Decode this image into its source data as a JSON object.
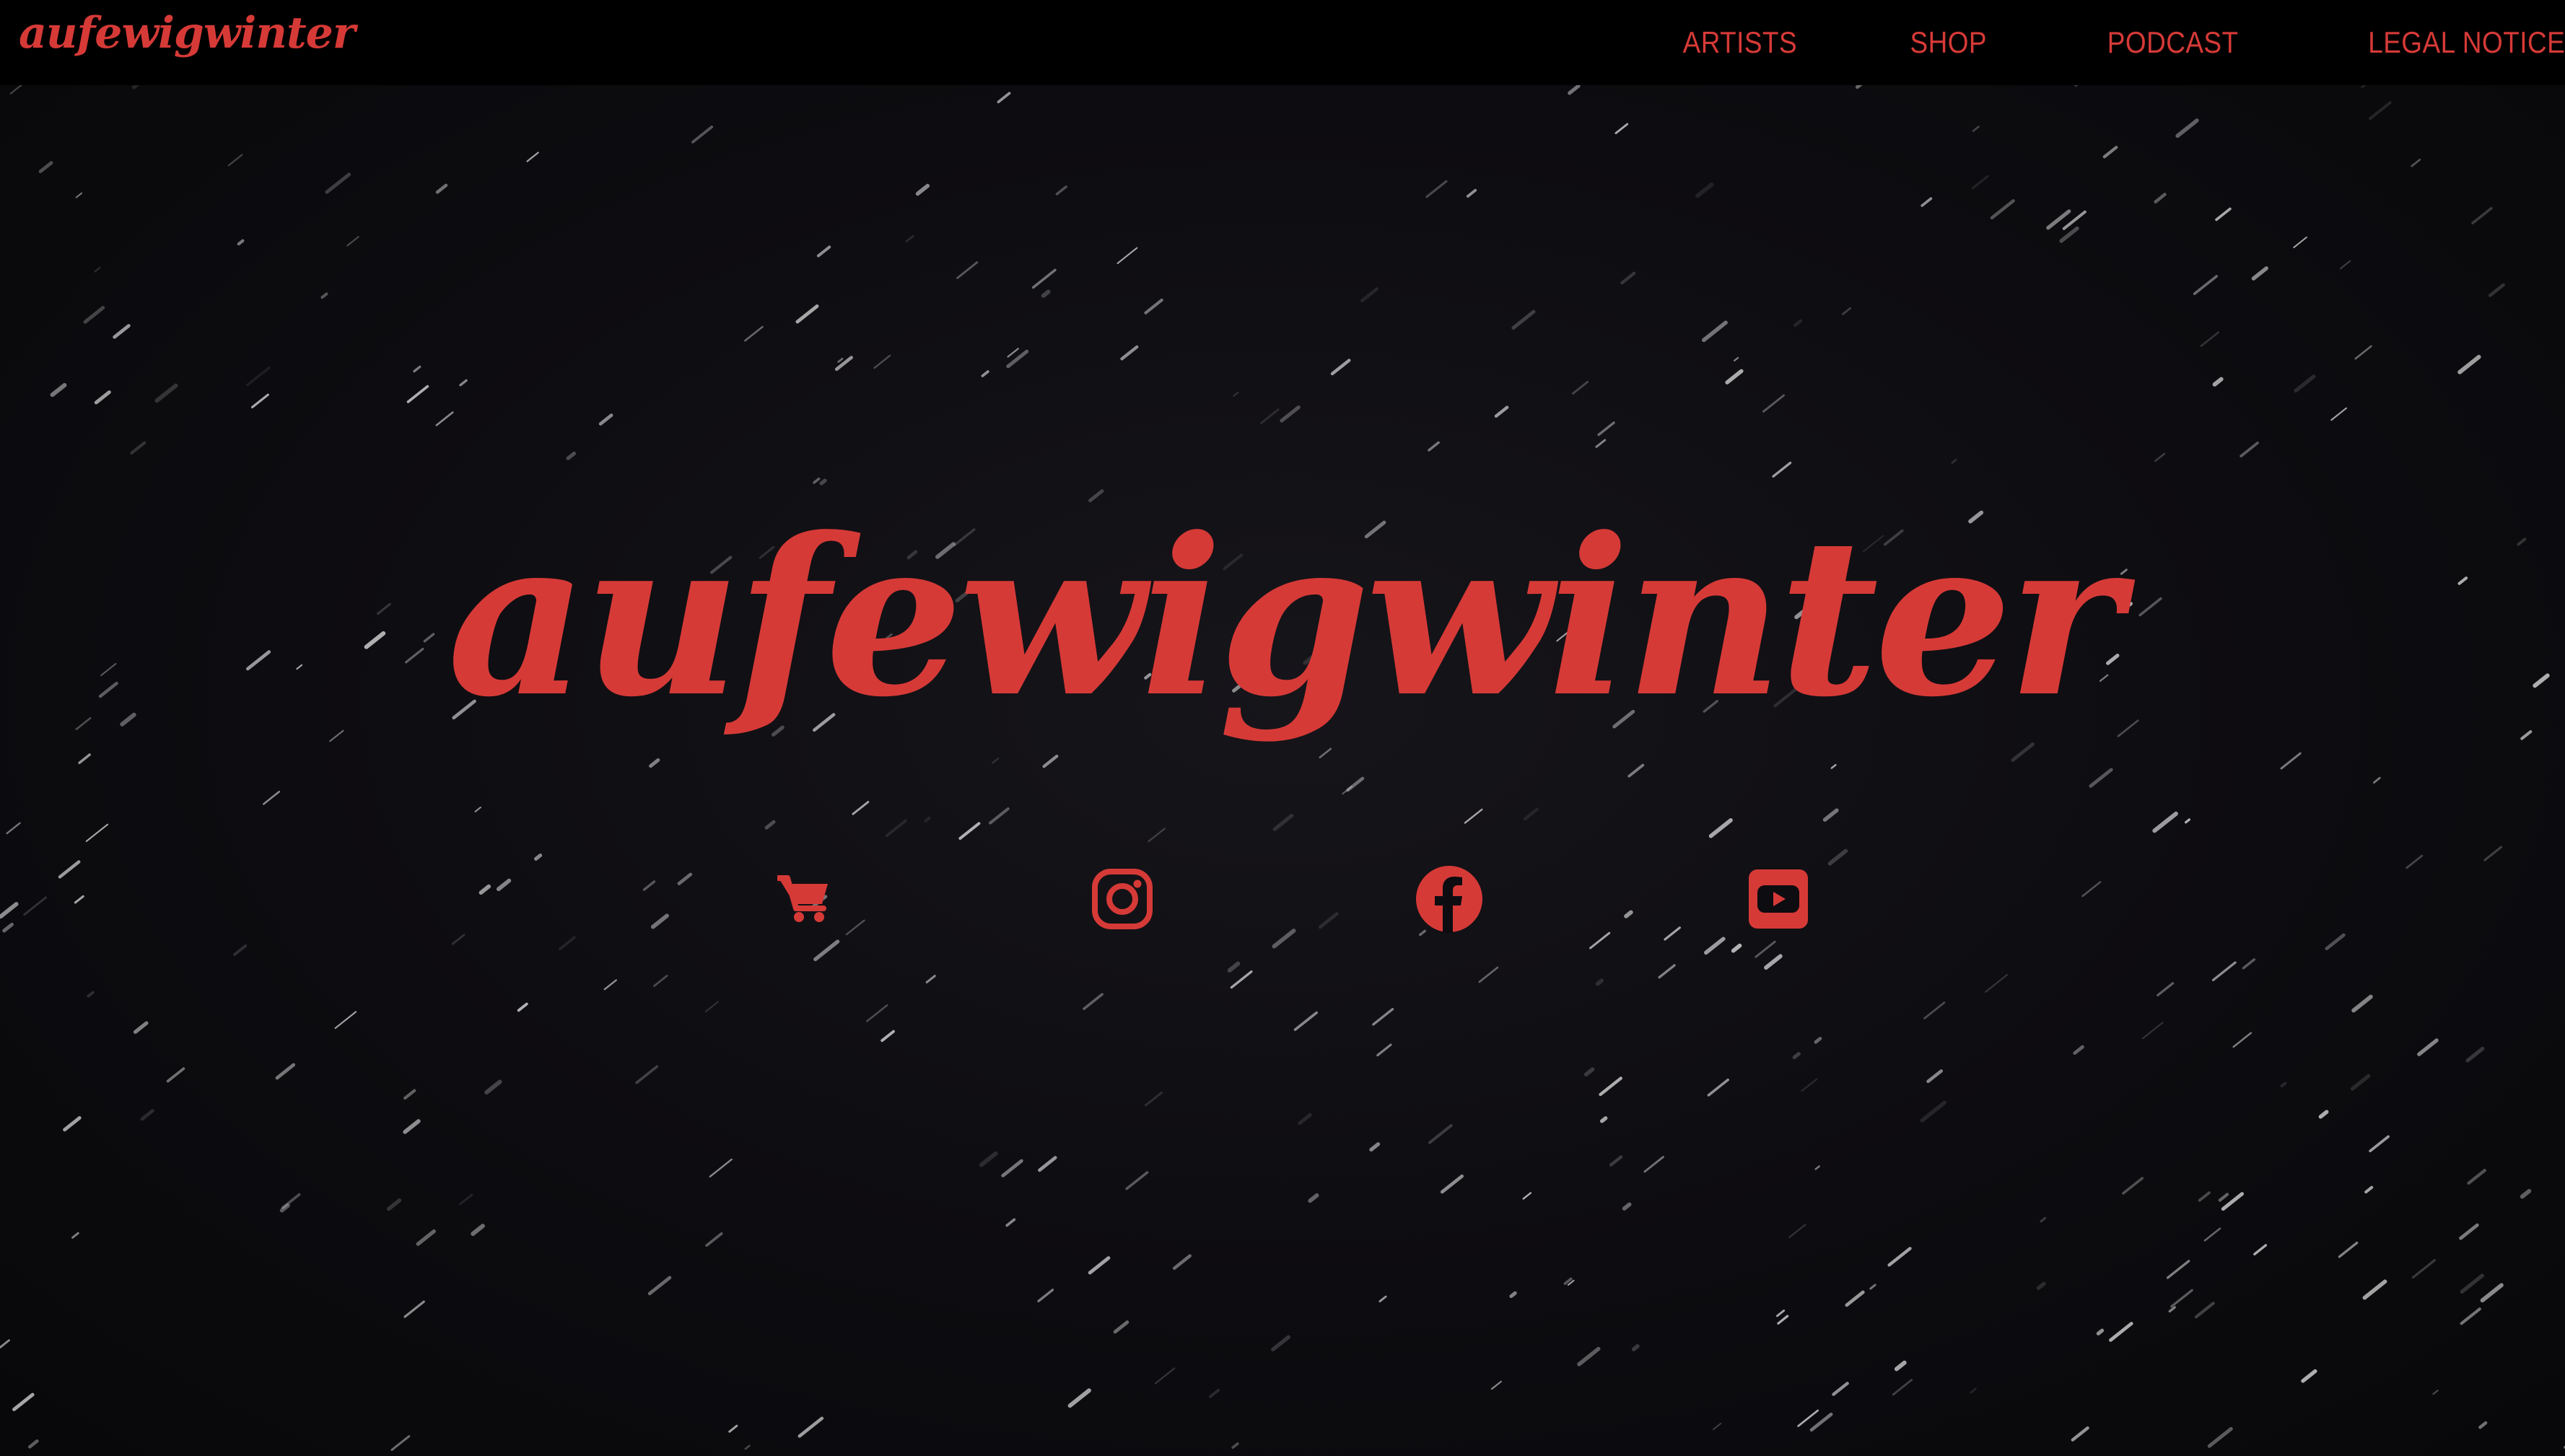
{
  "header": {
    "brand": "aufewigwinter",
    "nav": [
      {
        "label": "ARTISTS"
      },
      {
        "label": "SHOP"
      },
      {
        "label": "PODCAST"
      },
      {
        "label": "LEGAL NOTICE"
      }
    ]
  },
  "hero": {
    "logo_text": "aufewigwinter",
    "background": "snowfall-video-still"
  },
  "socials": [
    {
      "icon": "shopping-cart-icon"
    },
    {
      "icon": "instagram-icon"
    },
    {
      "icon": "facebook-icon"
    },
    {
      "icon": "youtube-icon"
    }
  ],
  "colors": {
    "accent": "#d63a37",
    "header_bg": "#000000",
    "hero_bg": "#0d0c10",
    "snow": "#ffffff"
  }
}
